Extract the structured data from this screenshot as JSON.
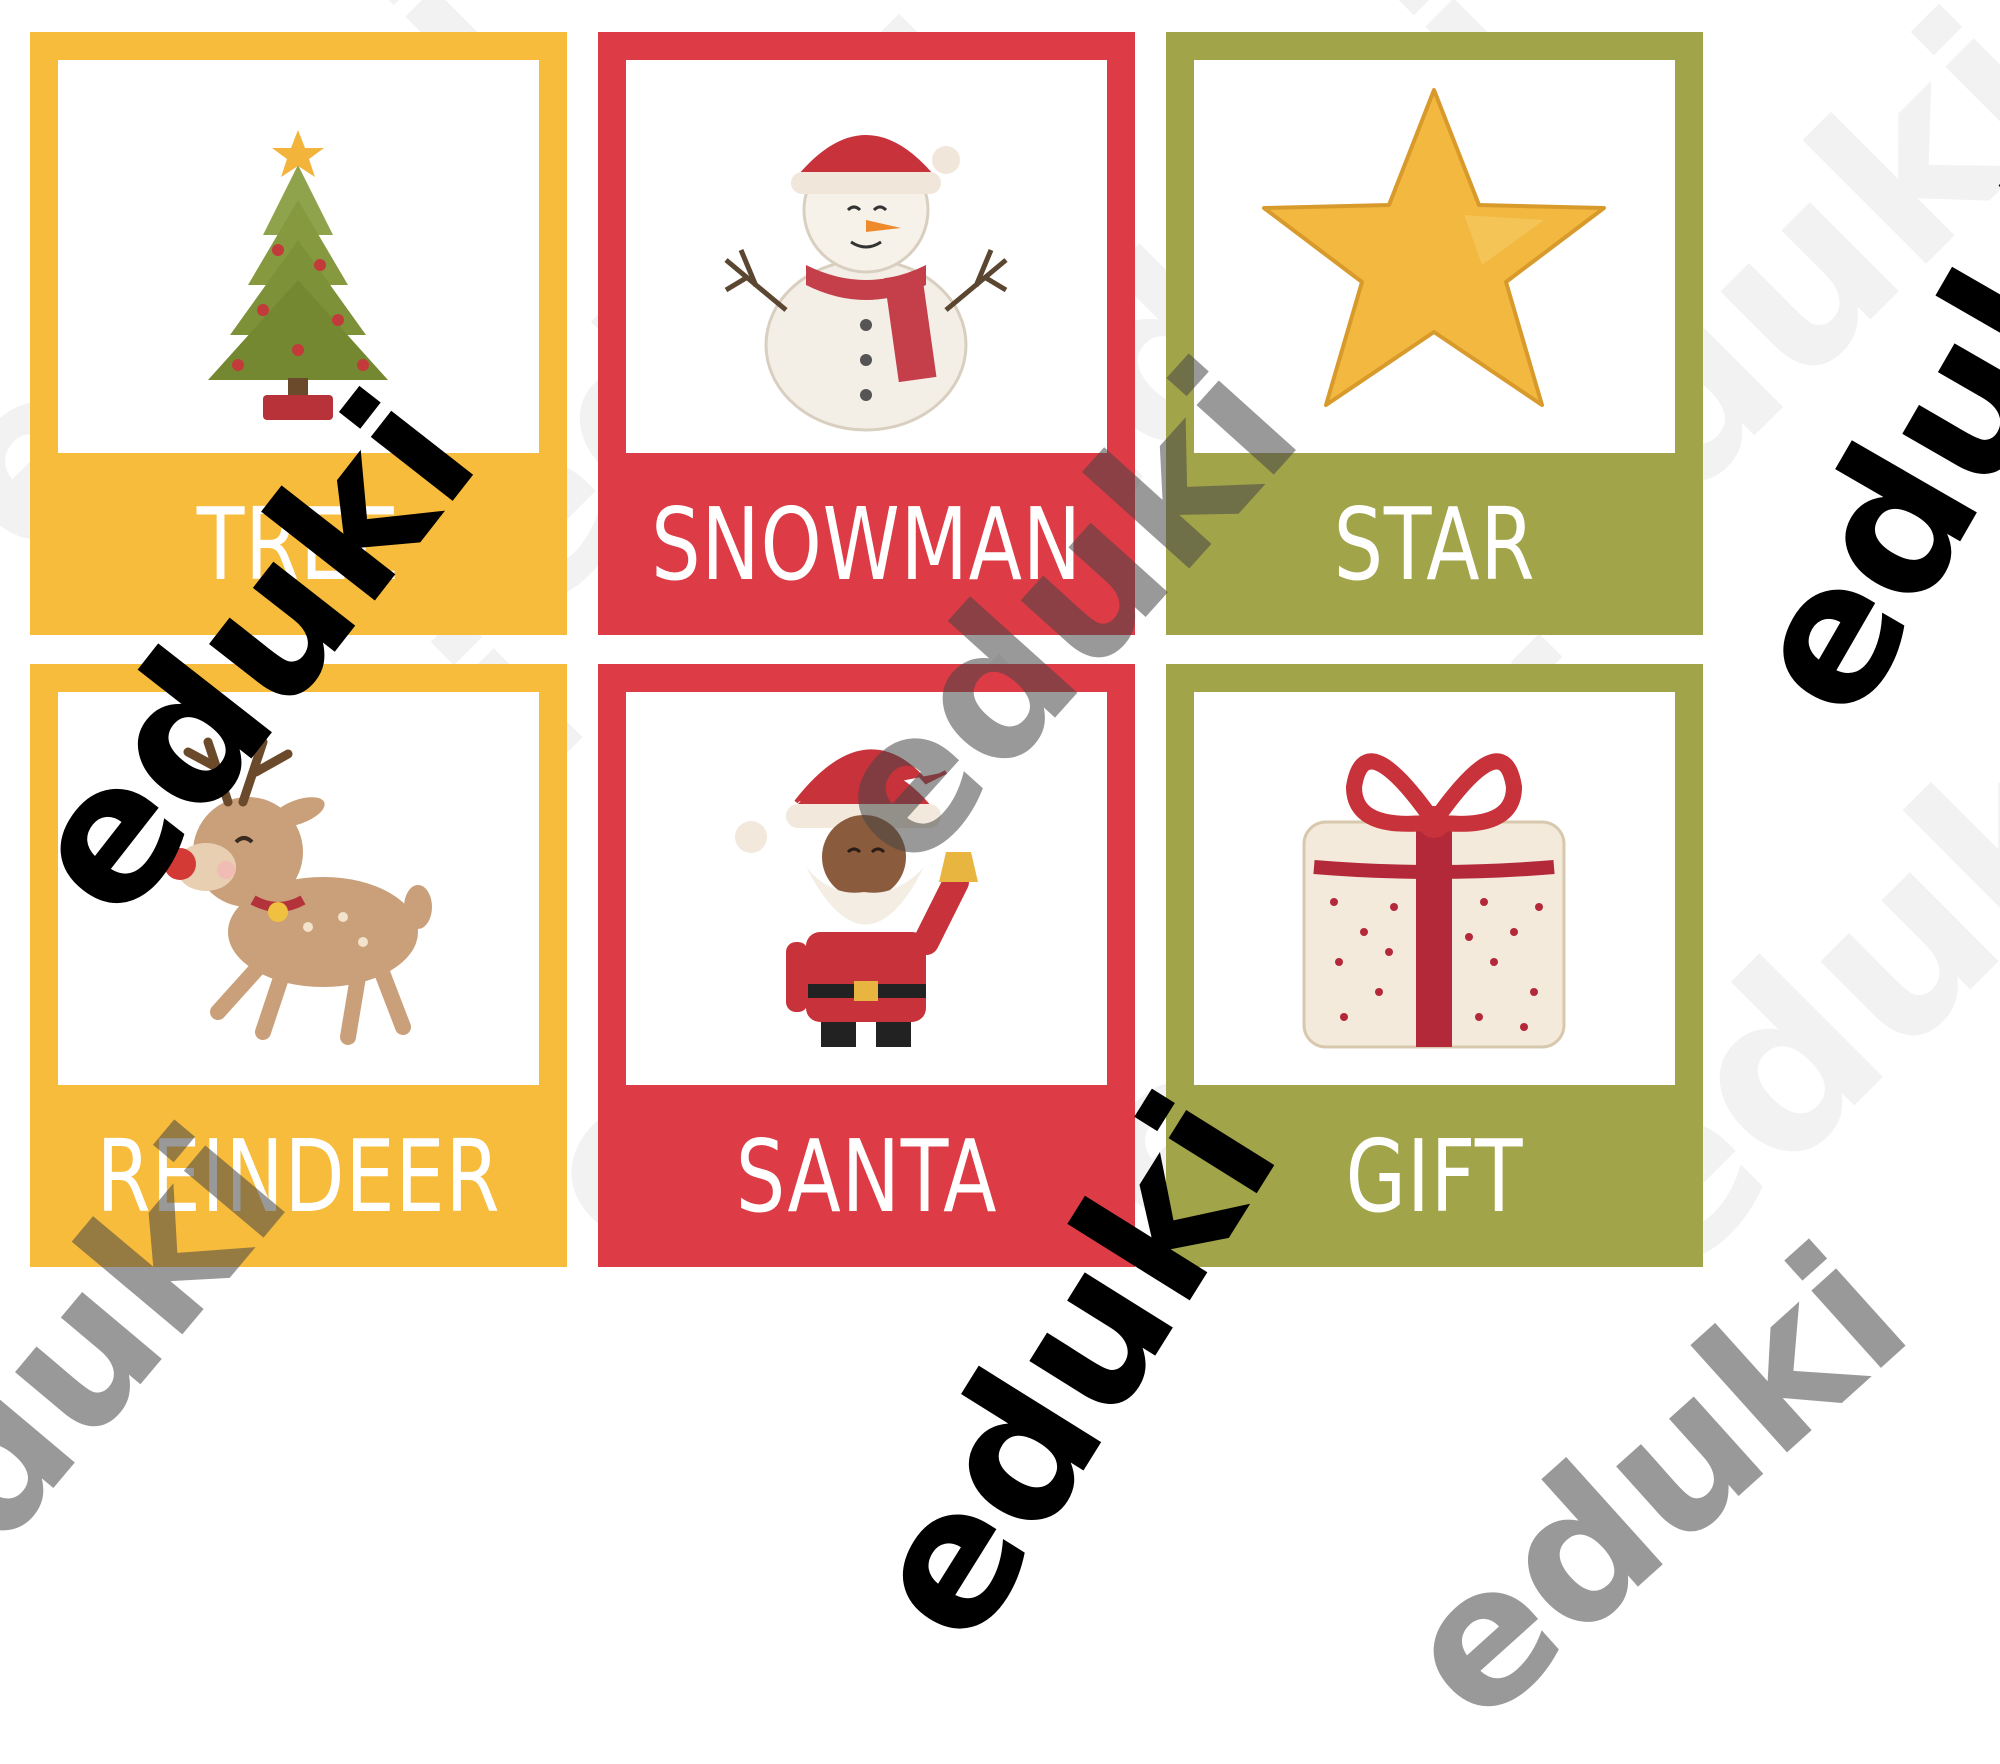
{
  "colors": {
    "yellow": "#F7BC3C",
    "red": "#DD3B45",
    "olive": "#A2A44A",
    "card_window": "#FFFFFF",
    "label_text": "#FFFFFF"
  },
  "cards": [
    {
      "label": "TREE",
      "color": "yellow",
      "icon": "christmas-tree-icon"
    },
    {
      "label": "SNOWMAN",
      "color": "red",
      "icon": "snowman-icon"
    },
    {
      "label": "STAR",
      "color": "olive",
      "icon": "star-icon"
    },
    {
      "label": "REINDEER",
      "color": "yellow",
      "icon": "reindeer-icon"
    },
    {
      "label": "SANTA",
      "color": "red",
      "icon": "santa-icon"
    },
    {
      "label": "GIFT",
      "color": "olive",
      "icon": "gift-icon"
    }
  ],
  "watermark": {
    "text": "eduki"
  }
}
